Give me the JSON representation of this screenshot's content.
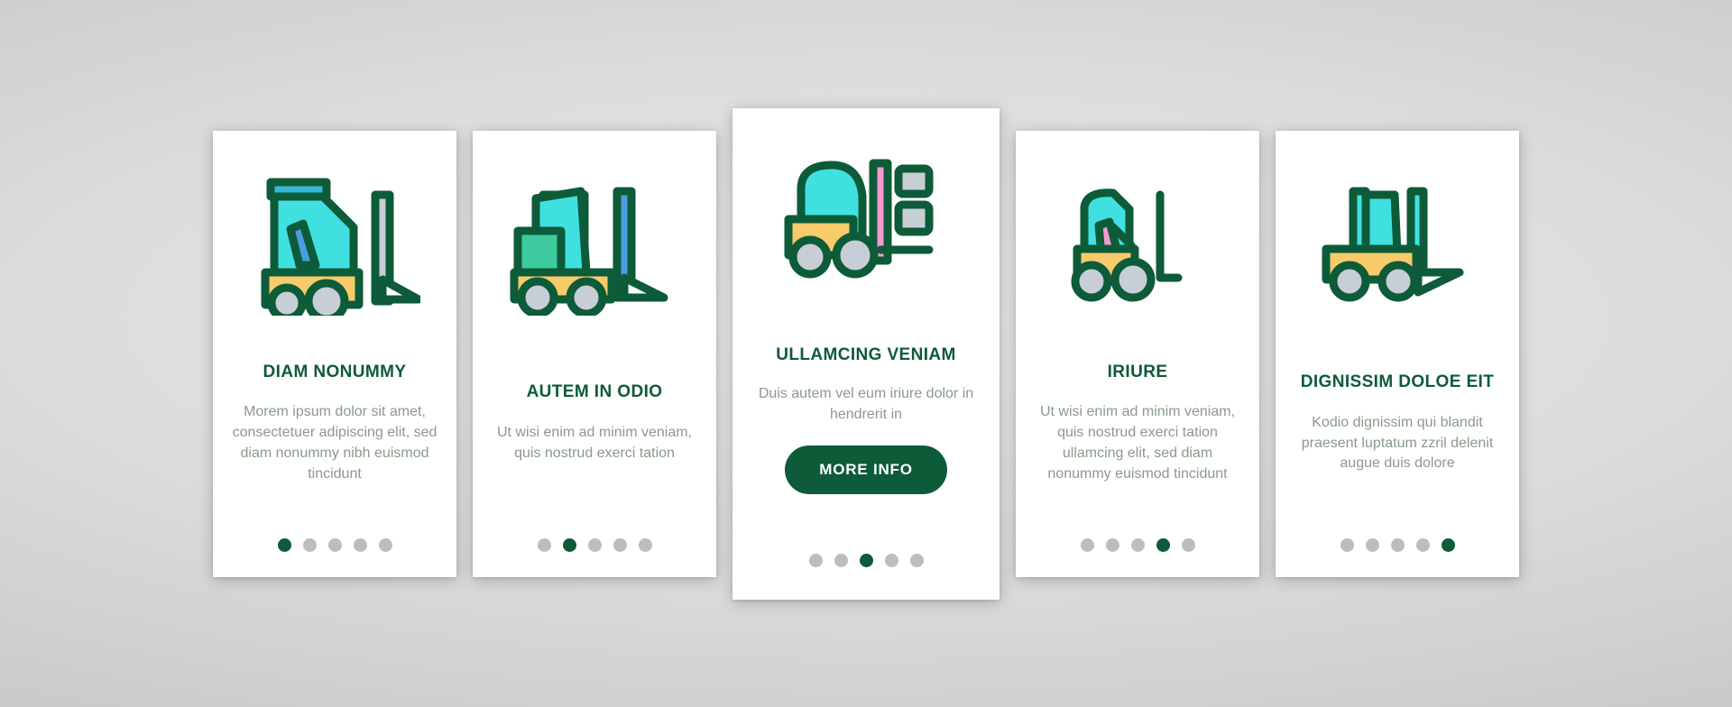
{
  "theme": {
    "brand_green": "#0d5b38",
    "body_text": "#8a9a8a",
    "dot_inactive": "#bdbdbd",
    "icon_cyan": "#41e0e0",
    "icon_yellow": "#f8cb6a",
    "icon_teal": "#3ecba0",
    "icon_pink": "#f49bd0",
    "icon_gray": "#c7ced6",
    "icon_blue": "#4a9ede",
    "icon_outline": "#0d5b38",
    "card_bg": "#ffffff",
    "page_bg": "#d5d5d5"
  },
  "cards": [
    {
      "id": "card-1",
      "icon_name": "forklift-icon-1",
      "title": "DIAM NONUMMY",
      "body": "Morem ipsum dolor sit amet, consectetuer adipiscing elit, sed diam nonummy nibh euismod tincidunt",
      "featured": false,
      "cta_label": null,
      "dots": {
        "count": 5,
        "active_index": 0
      }
    },
    {
      "id": "card-2",
      "icon_name": "forklift-icon-2",
      "title": "AUTEM IN ODIO",
      "body": "Ut wisi enim ad minim veniam, quis nostrud exerci tation",
      "featured": false,
      "cta_label": null,
      "dots": {
        "count": 5,
        "active_index": 1
      }
    },
    {
      "id": "card-3",
      "icon_name": "forklift-icon-3",
      "title": "ULLAMCING VENIAM",
      "body": "Duis autem vel eum iriure dolor in hendrerit in",
      "featured": true,
      "cta_label": "MORE INFO",
      "dots": {
        "count": 5,
        "active_index": 2
      }
    },
    {
      "id": "card-4",
      "icon_name": "forklift-icon-4",
      "title": "IRIURE",
      "body": "Ut wisi enim ad minim veniam, quis nostrud exerci tation ullamcing elit, sed diam nonummy euismod tincidunt",
      "featured": false,
      "cta_label": null,
      "dots": {
        "count": 5,
        "active_index": 3
      }
    },
    {
      "id": "card-5",
      "icon_name": "forklift-icon-5",
      "title": "DIGNISSIM DOLOE EIT",
      "body": "Kodio dignissim qui blandit praesent luptatum zzril delenit augue duis dolore",
      "featured": false,
      "cta_label": null,
      "dots": {
        "count": 5,
        "active_index": 4
      }
    }
  ]
}
